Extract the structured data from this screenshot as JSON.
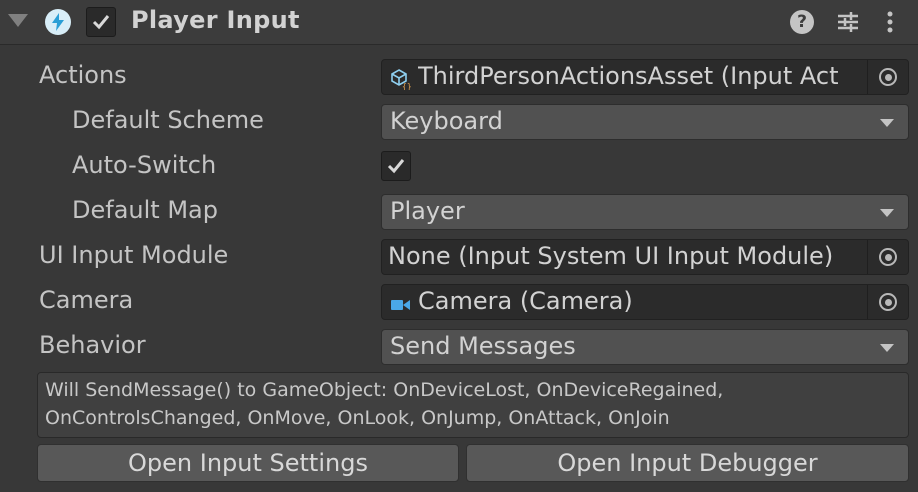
{
  "header": {
    "title": "Player Input",
    "enabled": true,
    "icons": [
      "foldout-arrow-icon",
      "input-system-icon",
      "help-icon",
      "presets-icon",
      "kebab-menu-icon"
    ]
  },
  "fields": {
    "actions": {
      "label": "Actions",
      "value": "ThirdPersonActionsAsset (Input Act",
      "icon": "input-actions-asset-icon"
    },
    "default_scheme": {
      "label": "Default Scheme",
      "value": "Keyboard"
    },
    "auto_switch": {
      "label": "Auto-Switch",
      "checked": true
    },
    "default_map": {
      "label": "Default Map",
      "value": "Player"
    },
    "ui_input_module": {
      "label": "UI Input Module",
      "value": "None (Input System UI Input Module)"
    },
    "camera": {
      "label": "Camera",
      "value": "Camera (Camera)",
      "icon": "camera-icon"
    },
    "behavior": {
      "label": "Behavior",
      "value": "Send Messages"
    }
  },
  "help": {
    "line1": "Will SendMessage() to GameObject: OnDeviceLost, OnDeviceRegained,",
    "line2": "OnControlsChanged, OnMove, OnLook, OnJump, OnAttack, OnJoin"
  },
  "buttons": {
    "open_settings": "Open Input Settings",
    "open_debugger": "Open Input Debugger"
  },
  "colors": {
    "background": "#383838",
    "field": "#2b2b2b",
    "dropdown": "#515151",
    "button": "#585858",
    "accent_icon": "#2a9fd6",
    "camera_icon": "#4aa8e8"
  }
}
